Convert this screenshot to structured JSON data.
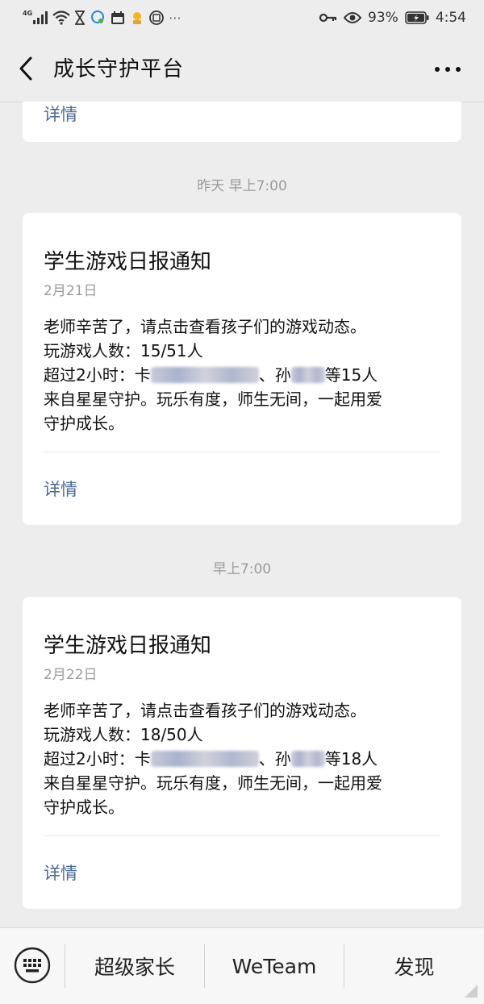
{
  "status_bar": {
    "network": "4G",
    "battery_percent": "93%",
    "time": "4:54"
  },
  "nav": {
    "title": "成长守护平台"
  },
  "previous_card": {
    "detail_label": "详情"
  },
  "messages": [
    {
      "timestamp_label": "昨天 早上7:00",
      "title": "学生游戏日报通知",
      "date": "2月21日",
      "line1": "老师辛苦了，请点击查看孩子们的游戏动态。",
      "line2": "玩游戏人数：15/51人",
      "line3_prefix": "超过2小时：卡",
      "line3_mid": "、孙",
      "line3_suffix": "等15人",
      "line4": "来自星星守护。玩乐有度，师生无间，一起用爱",
      "line5": "守护成长。",
      "detail_label": "详情"
    },
    {
      "timestamp_label": "早上7:00",
      "title": "学生游戏日报通知",
      "date": "2月22日",
      "line1": "老师辛苦了，请点击查看孩子们的游戏动态。",
      "line2": "玩游戏人数：18/50人",
      "line3_prefix": "超过2小时：卡",
      "line3_mid": "、孙",
      "line3_suffix": "等18人",
      "line4": "来自星星守护。玩乐有度，师生无间，一起用爱",
      "line5": "守护成长。",
      "detail_label": "详情"
    }
  ],
  "bottom_menu": {
    "items": [
      "超级家长",
      "WeTeam",
      "发现"
    ]
  },
  "colors": {
    "background": "#ededed",
    "card": "#ffffff",
    "link": "#4a6a96",
    "muted": "#9b9b9b"
  }
}
